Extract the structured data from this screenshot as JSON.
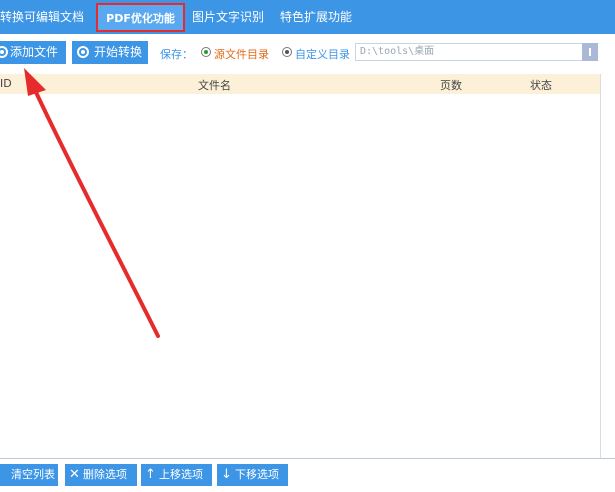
{
  "tabs": [
    {
      "label": "转换可编辑文档"
    },
    {
      "label": "PDF优化功能"
    },
    {
      "label": "图片文字识别"
    },
    {
      "label": "特色扩展功能"
    }
  ],
  "toolbar": {
    "add_file_label": "添加文件",
    "start_convert_label": "开始转换",
    "save_label": "保存：",
    "radio_source_dir": "源文件目录",
    "radio_custom_dir": "自定义目录",
    "path_value": "D:\\tools\\桌面"
  },
  "table": {
    "columns": [
      "ID",
      "文件名",
      "页数",
      "状态"
    ]
  },
  "bottom": {
    "clear_list": "清空列表",
    "delete_item": "删除选项",
    "move_up": "上移选项",
    "move_down": "下移选项"
  },
  "colors": {
    "accent": "#3d95e6",
    "highlight_border": "#e52b2b",
    "arrow": "#e52b2b"
  }
}
